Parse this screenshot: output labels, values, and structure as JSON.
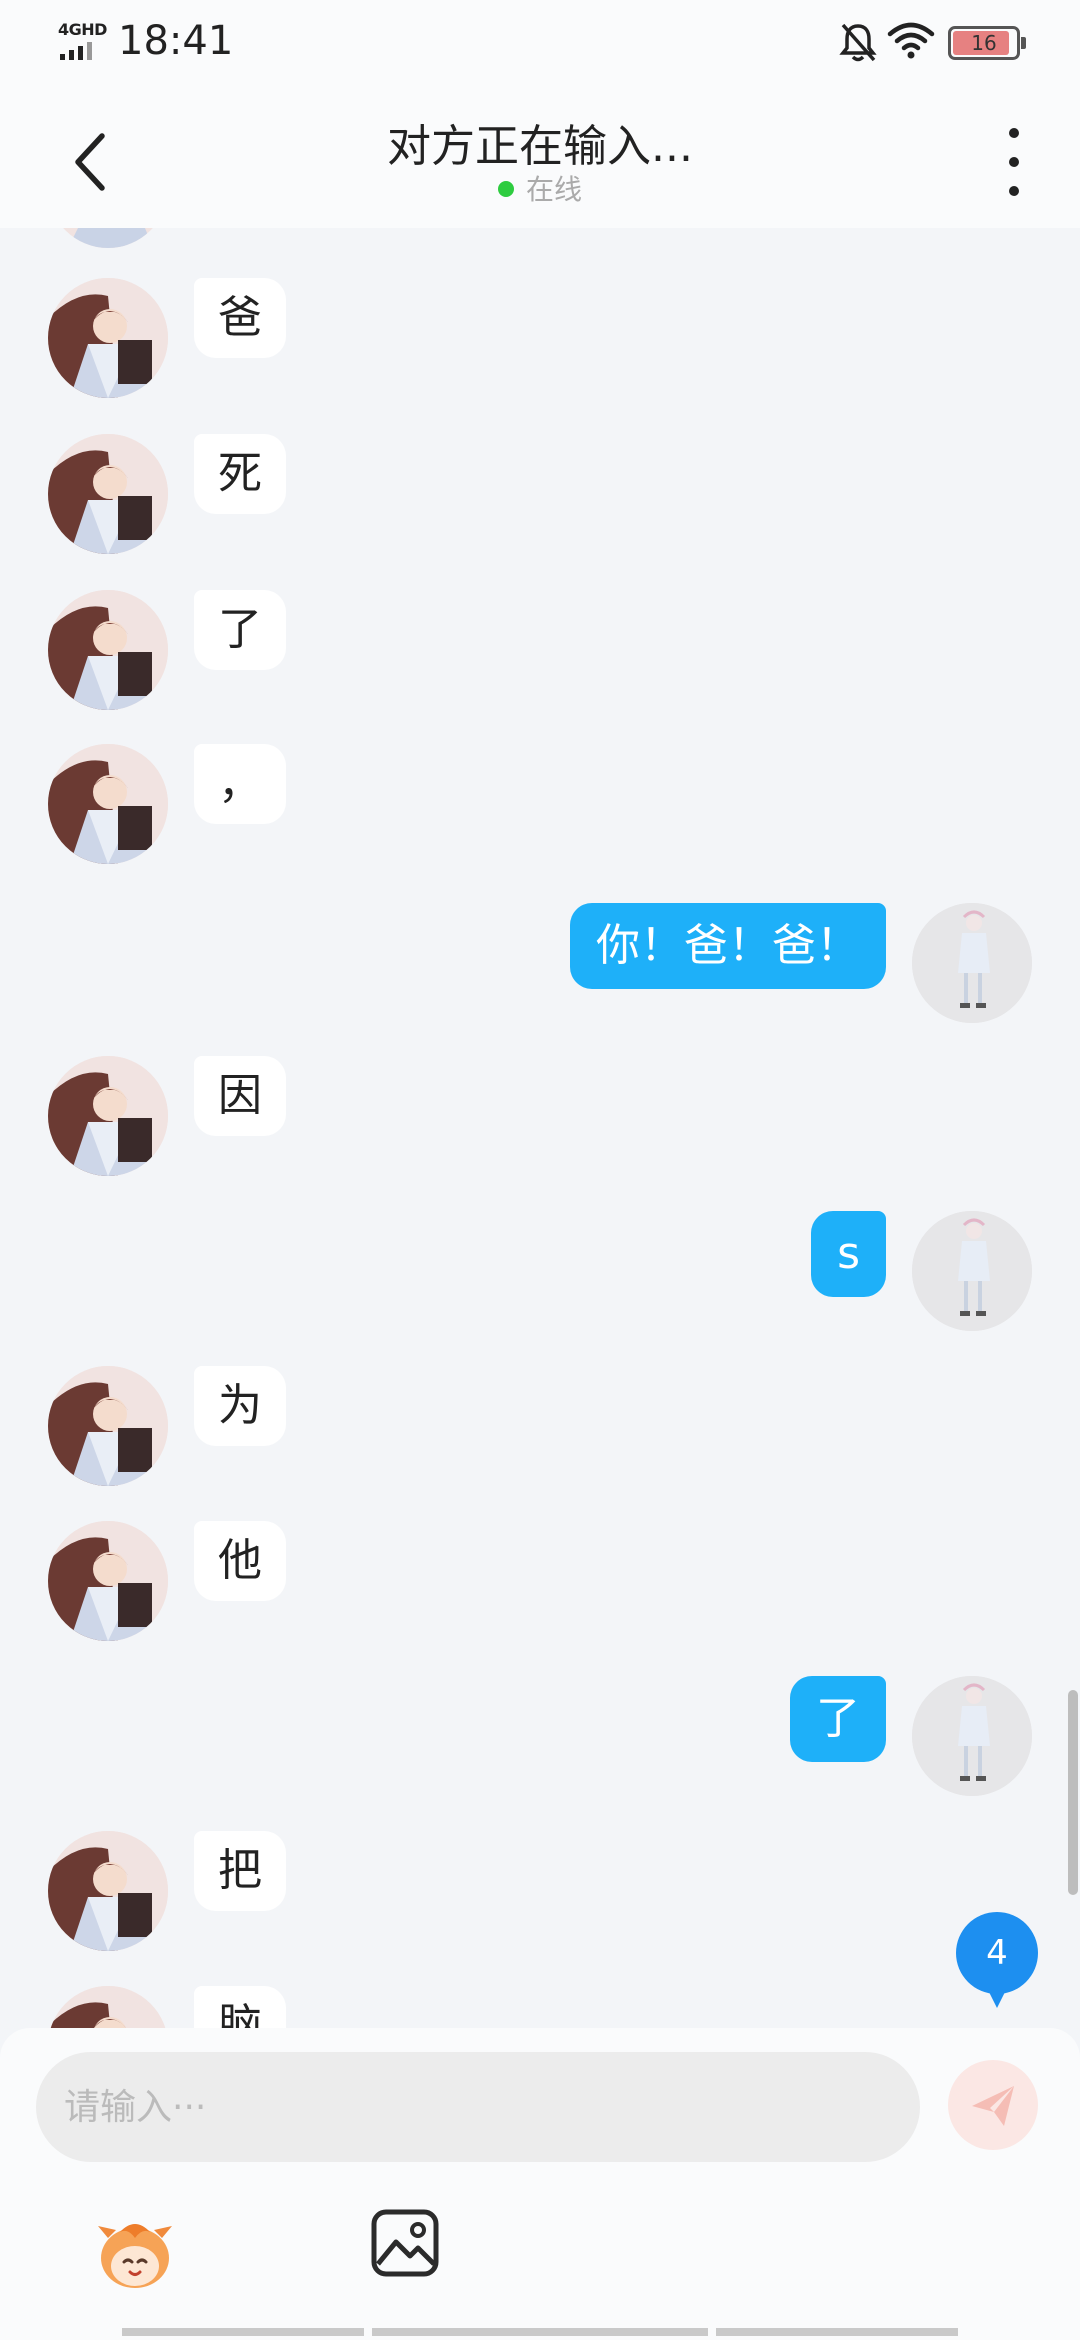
{
  "status_bar": {
    "network": "4GHD",
    "time": "18:41",
    "battery": "16",
    "icons": [
      "signal-bars-icon",
      "mute-bell-icon",
      "wifi-icon",
      "battery-icon"
    ]
  },
  "header": {
    "title": "对方正在输入...",
    "status": "在线",
    "icons": [
      "back-chevron-icon",
      "more-vertical-icon"
    ]
  },
  "messages": [
    {
      "side": "left",
      "text": "爸"
    },
    {
      "side": "left",
      "text": "死"
    },
    {
      "side": "left",
      "text": "了"
    },
    {
      "side": "left",
      "text": "，"
    },
    {
      "side": "right",
      "text": "你！爸！爸！"
    },
    {
      "side": "left",
      "text": "因"
    },
    {
      "side": "right",
      "text": "s"
    },
    {
      "side": "left",
      "text": "为"
    },
    {
      "side": "left",
      "text": "他"
    },
    {
      "side": "right",
      "text": "了"
    },
    {
      "side": "left",
      "text": "把"
    },
    {
      "side": "left",
      "text": "脑"
    }
  ],
  "unread_count": "4",
  "input": {
    "placeholder": "请输入···",
    "value": ""
  },
  "toolbar": {
    "icons": [
      "emoji-mascot-icon",
      "image-picker-icon",
      "send-paper-plane-icon"
    ]
  },
  "colors": {
    "background": "#f3f5f8",
    "outgoing_bubble": "#1eb0f9",
    "incoming_bubble": "#ffffff",
    "online_dot": "#2ecc40",
    "unread_badge": "#1d8ff0"
  }
}
